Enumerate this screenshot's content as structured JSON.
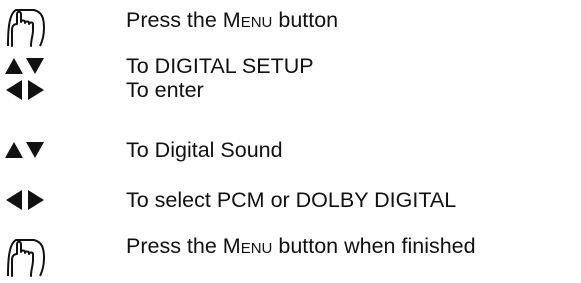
{
  "steps": [
    {
      "icon": "hand-press-icon",
      "text_before": "Press the ",
      "text_smallcaps": "Menu",
      "text_after": " button"
    },
    {
      "icon": "up-down-arrows-icon",
      "text": "To DIGITAL SETUP"
    },
    {
      "icon": "left-right-arrows-icon",
      "text": "To enter"
    },
    {
      "icon": "up-down-arrows-icon",
      "text": "To Digital Sound"
    },
    {
      "icon": "left-right-arrows-icon",
      "text": "To select PCM or DOLBY DIGITAL"
    },
    {
      "icon": "hand-press-icon",
      "text_before": "Press the ",
      "text_smallcaps": "Menu",
      "text_after": " button when finished"
    }
  ]
}
